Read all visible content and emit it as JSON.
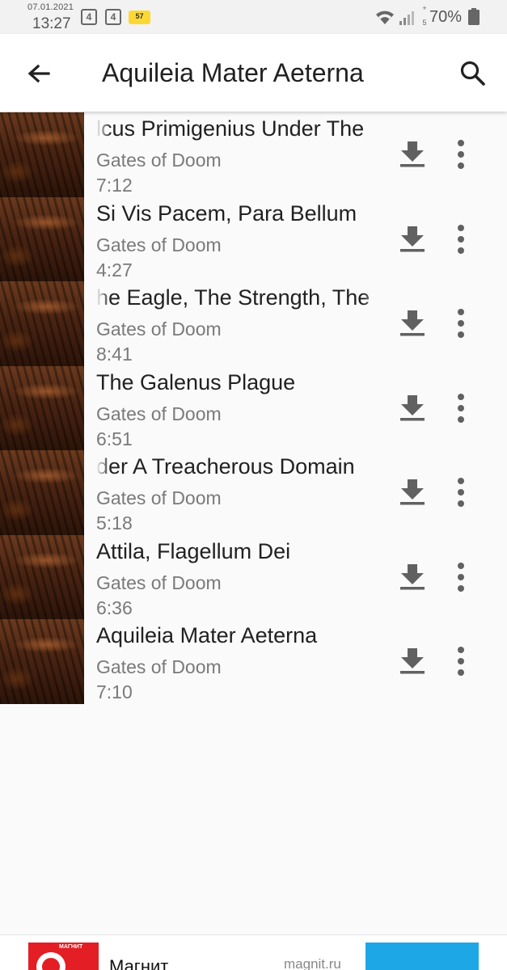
{
  "status_bar": {
    "date": "07.01.2021",
    "time": "13:27",
    "notification_1": "4",
    "notification_2": "4",
    "badge": "57",
    "network_plus": "+",
    "network_label": "5",
    "battery_percent": "70%"
  },
  "app_bar": {
    "title": "Aquileia Mater Aeterna",
    "back_icon": "arrow-left-icon",
    "search_icon": "search-icon"
  },
  "tracks": [
    {
      "title": "lcus Primigenius Under The",
      "artist": "Gates of Doom",
      "duration": "7:12"
    },
    {
      "title": "Si Vis Pacem, Para Bellum",
      "artist": "Gates of Doom",
      "duration": "4:27"
    },
    {
      "title": "he Eagle, The Strength, The",
      "artist": "Gates of Doom",
      "duration": "8:41"
    },
    {
      "title": "The Galenus Plague",
      "artist": "Gates of Doom",
      "duration": "6:51"
    },
    {
      "title": "der A Treacherous Domain",
      "artist": "Gates of Doom",
      "duration": "5:18"
    },
    {
      "title": "Attila, Flagellum Dei",
      "artist": "Gates of Doom",
      "duration": "6:36"
    },
    {
      "title": "Aquileia Mater Aeterna",
      "artist": "Gates of Doom",
      "duration": "7:10"
    }
  ],
  "ad": {
    "logo_text": "МАГНИТ",
    "title": "Магнит",
    "domain": "magnit.ru",
    "accent_color": "#e31e24",
    "cta_color": "#1ea7e6"
  }
}
